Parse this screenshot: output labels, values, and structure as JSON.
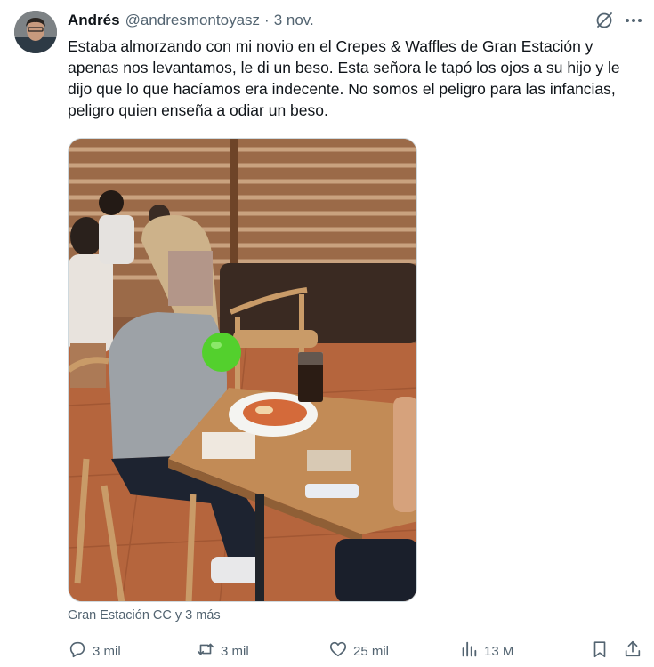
{
  "tweet": {
    "author_name": "Andrés",
    "handle": "@andresmontoyasz",
    "separator": "·",
    "date": "3 nov.",
    "text": "Estaba almorzando con mi novio en el Crepes & Waffles de Gran Estación y apenas nos levantamos, le di un beso. Esta señora le tapó los ojos a su hijo y le dijo que lo que hacíamos era indecente. No somos el peligro para las infancias, peligro quien enseña a odiar un beso.",
    "location": "Gran Estación CC y 3 más"
  },
  "actions": {
    "replies": "3 mil",
    "reposts": "3 mil",
    "likes": "25 mil",
    "views": "13 M"
  },
  "icons": {
    "grok": "grok-icon",
    "more": "more-icon",
    "reply": "reply-icon",
    "repost": "repost-icon",
    "like": "heart-icon",
    "views": "views-icon",
    "bookmark": "bookmark-icon",
    "share": "share-icon"
  },
  "colors": {
    "text": "#0f1419",
    "secondary": "#536471",
    "border": "#cfd9de"
  }
}
